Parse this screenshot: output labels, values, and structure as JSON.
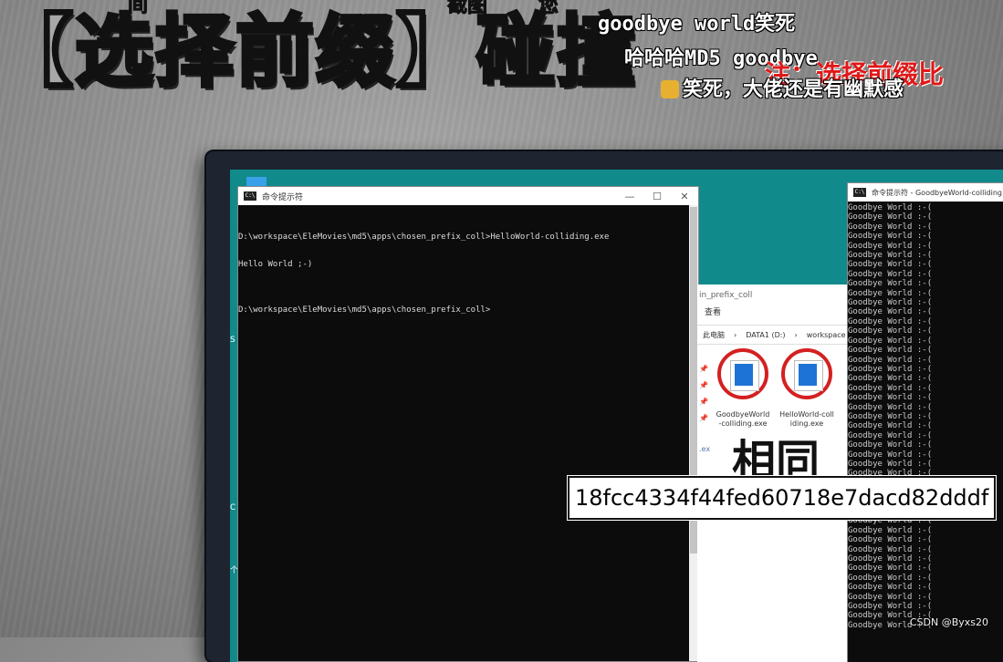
{
  "headline": {
    "text": "【选择前缀】碰撞"
  },
  "top_cut_texts": [
    "间",
    "截图",
    "您"
  ],
  "danmaku": [
    {
      "text": "goodbye world笑死"
    },
    {
      "text": "哈哈哈MD5 goodbye"
    },
    {
      "text": "笑死，大佬还是有幽默感"
    }
  ],
  "red_note": "注：选择前缀比",
  "desktop": {
    "edge_letters": [
      "S",
      "C",
      "个"
    ]
  },
  "left_terminal": {
    "title": "命令提示符",
    "icon_text": "C:\\",
    "buttons": {
      "minimize": "—",
      "maximize": "☐",
      "close": "✕"
    },
    "lines": [
      "D:\\workspace\\EleMovies\\md5\\apps\\chosen_prefix_coll>HelloWorld-colliding.exe",
      "Hello World ;-)",
      "",
      "D:\\workspace\\EleMovies\\md5\\apps\\chosen_prefix_coll>"
    ]
  },
  "explorer": {
    "title": "in_prefix_coll",
    "tab": "查看",
    "address": [
      "此电脑",
      "›",
      "DATA1 (D:)",
      "›",
      "workspace",
      "›"
    ],
    "side_ext": ".ex",
    "files": [
      {
        "name": "GoodbyeWorld\n-colliding.exe"
      },
      {
        "name": "HelloWorld-coll\niding.exe"
      }
    ]
  },
  "right_terminal": {
    "title": "命令提示符 - GoodbyeWorld-colliding.exe",
    "line_text": "Goodbye World :-(",
    "line_count": 45
  },
  "overlay": {
    "same_label": "相同",
    "hash": "18fcc4334f44fed60718e7dacd82dddf"
  },
  "watermark": "CSDN @Byxs20",
  "colors": {
    "accent_red": "#d42020",
    "desktop_teal": "#118a8c"
  }
}
